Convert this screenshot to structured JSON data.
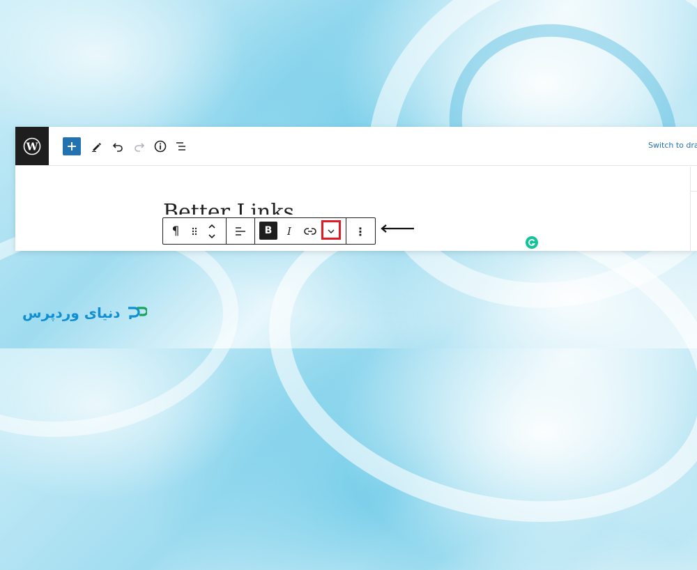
{
  "background": {
    "accent": "#6fcbe8"
  },
  "topbar": {
    "logo_icon": "wordpress-logo-icon",
    "add_block_icon": "plus-icon",
    "tools_icon": "pencil-icon",
    "undo_icon": "undo-icon",
    "redo_icon": "redo-icon",
    "details_icon": "info-icon",
    "list_view_icon": "list-view-icon",
    "switch_to_draft": "Switch to draft"
  },
  "content": {
    "paragraph_text": "Better Links"
  },
  "block_toolbar": {
    "paragraph_icon": "¶",
    "drag_icon": "drag-handle-icon",
    "move_icon": "move-up-down-icon",
    "align_icon": "align-left-icon",
    "bold_label": "B",
    "italic_label": "I",
    "link_icon": "link-icon",
    "more_icon": "chevron-down-icon",
    "options_icon": "⋮",
    "highlight_color": "#e01b24"
  },
  "annotation": {
    "arrow_icon": "left-arrow-icon"
  },
  "grammarly": {
    "icon": "grammarly-icon",
    "color": "#15c39a"
  },
  "brand": {
    "text": "دنیای وردپرس",
    "color": "#0f8fd1"
  }
}
